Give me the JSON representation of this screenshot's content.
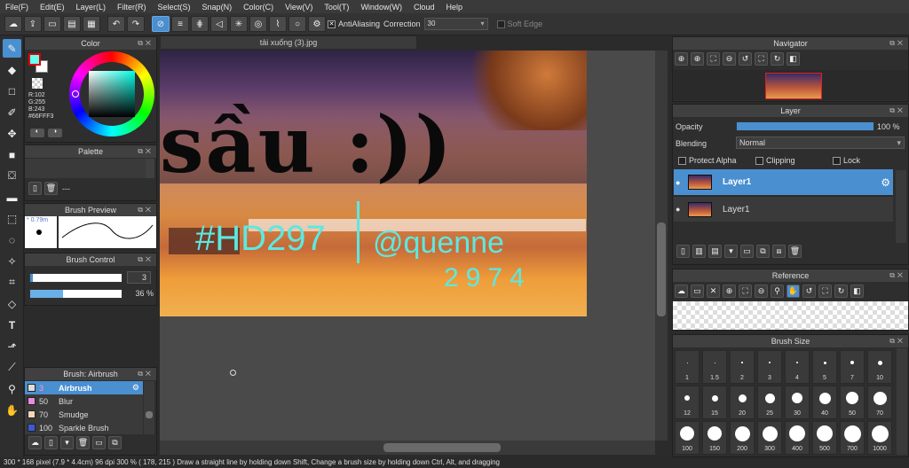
{
  "menu": [
    "File(F)",
    "Edit(E)",
    "Layer(L)",
    "Filter(R)",
    "Select(S)",
    "Snap(N)",
    "Color(C)",
    "View(V)",
    "Tool(T)",
    "Window(W)",
    "Cloud",
    "Help"
  ],
  "toolbar": {
    "antialiasing": "AntiAliasing",
    "correction_label": "Correction",
    "correction_value": "30",
    "soft_edge": "Soft Edge"
  },
  "document": {
    "tab_title": "tải xuống (3).jpg"
  },
  "color_panel": {
    "title": "Color",
    "r": "R:102",
    "g": "G:255",
    "b": "B:243",
    "hex": "#66FFF3",
    "accent": "#66FFF3"
  },
  "palette_panel": {
    "title": "Palette",
    "dashes": "---"
  },
  "brush_preview": {
    "title": "Brush Preview",
    "size": "0.79m"
  },
  "brush_control": {
    "title": "Brush Control",
    "size_value": "3",
    "opacity_value": "36 %"
  },
  "brush_panel": {
    "title": "Brush: Airbrush",
    "items": [
      {
        "num": "3",
        "name": "Airbrush",
        "color": "#dddddd"
      },
      {
        "num": "50",
        "name": "Blur",
        "color": "#e88ae0"
      },
      {
        "num": "70",
        "name": "Smudge",
        "color": "#f2d6b8"
      },
      {
        "num": "100",
        "name": "Sparkle Brush",
        "color": "#3b5ad8"
      }
    ]
  },
  "navigator": {
    "title": "Navigator"
  },
  "layer_panel": {
    "title": "Layer",
    "opacity_label": "Opacity",
    "opacity_value": "100 %",
    "opacity": 1.0,
    "blending_label": "Blending",
    "blending_value": "Normal",
    "protect_alpha": "Protect Alpha",
    "clipping": "Clipping",
    "lock": "Lock",
    "layers": [
      "Layer1",
      "Layer1"
    ]
  },
  "reference": {
    "title": "Reference"
  },
  "brush_size": {
    "title": "Brush Size",
    "sizes": [
      "1",
      "1.5",
      "2",
      "3",
      "4",
      "5",
      "7",
      "10",
      "12",
      "15",
      "20",
      "25",
      "30",
      "40",
      "50",
      "70",
      "100",
      "150",
      "200",
      "300",
      "400",
      "500",
      "700",
      "1000"
    ]
  },
  "canvas_text": {
    "big": "sầu :))",
    "hashtag": "#HD297",
    "handle": "@quenne",
    "num": "2974"
  },
  "status": "300 * 168 pixel   (7.9 * 4.4cm)   96 dpi   300 %   ( 178, 215 )   Draw a straight line by holding down Shift, Change a brush size by holding down Ctrl, Alt, and dragging"
}
